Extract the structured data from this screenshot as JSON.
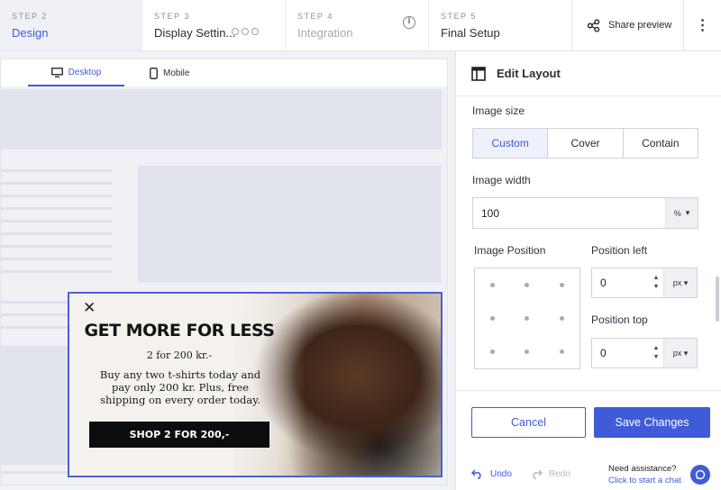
{
  "steps": [
    {
      "num": "STEP 2",
      "name": "Design",
      "state": "active"
    },
    {
      "num": "STEP 3",
      "name": "Display Settin...",
      "state": "in-progress"
    },
    {
      "num": "STEP 4",
      "name": "Integration",
      "state": "disabled"
    },
    {
      "num": "STEP 5",
      "name": "Final Setup",
      "state": "normal"
    }
  ],
  "share_label": "Share preview",
  "device_tabs": {
    "desktop": "Desktop",
    "mobile": "Mobile",
    "selected": "desktop"
  },
  "popup": {
    "title": "GET MORE FOR LESS",
    "subtitle": "2 for 200 kr.-",
    "body": "Buy any two t-shirts today and pay only 200 kr. Plus, free shipping on every order today.",
    "cta": "SHOP 2 FOR 200,-"
  },
  "panel": {
    "title": "Edit Layout",
    "image_size": {
      "label": "Image size",
      "options": [
        "Custom",
        "Cover",
        "Contain"
      ],
      "selected": "Custom"
    },
    "image_width": {
      "label": "Image width",
      "value": "100",
      "unit": "%"
    },
    "image_position": {
      "label": "Image Position"
    },
    "position_left": {
      "label": "Position left",
      "value": "0",
      "unit": "px"
    },
    "position_top": {
      "label": "Position top",
      "value": "0",
      "unit": "px"
    }
  },
  "footer": {
    "cancel": "Cancel",
    "save": "Save Changes",
    "undo": "Undo",
    "redo": "Redo",
    "help_question": "Need assistance?",
    "help_link": "Click to start a chat"
  },
  "colors": {
    "accent": "#3f5bd8",
    "popup_button": "#0d0d0f"
  }
}
